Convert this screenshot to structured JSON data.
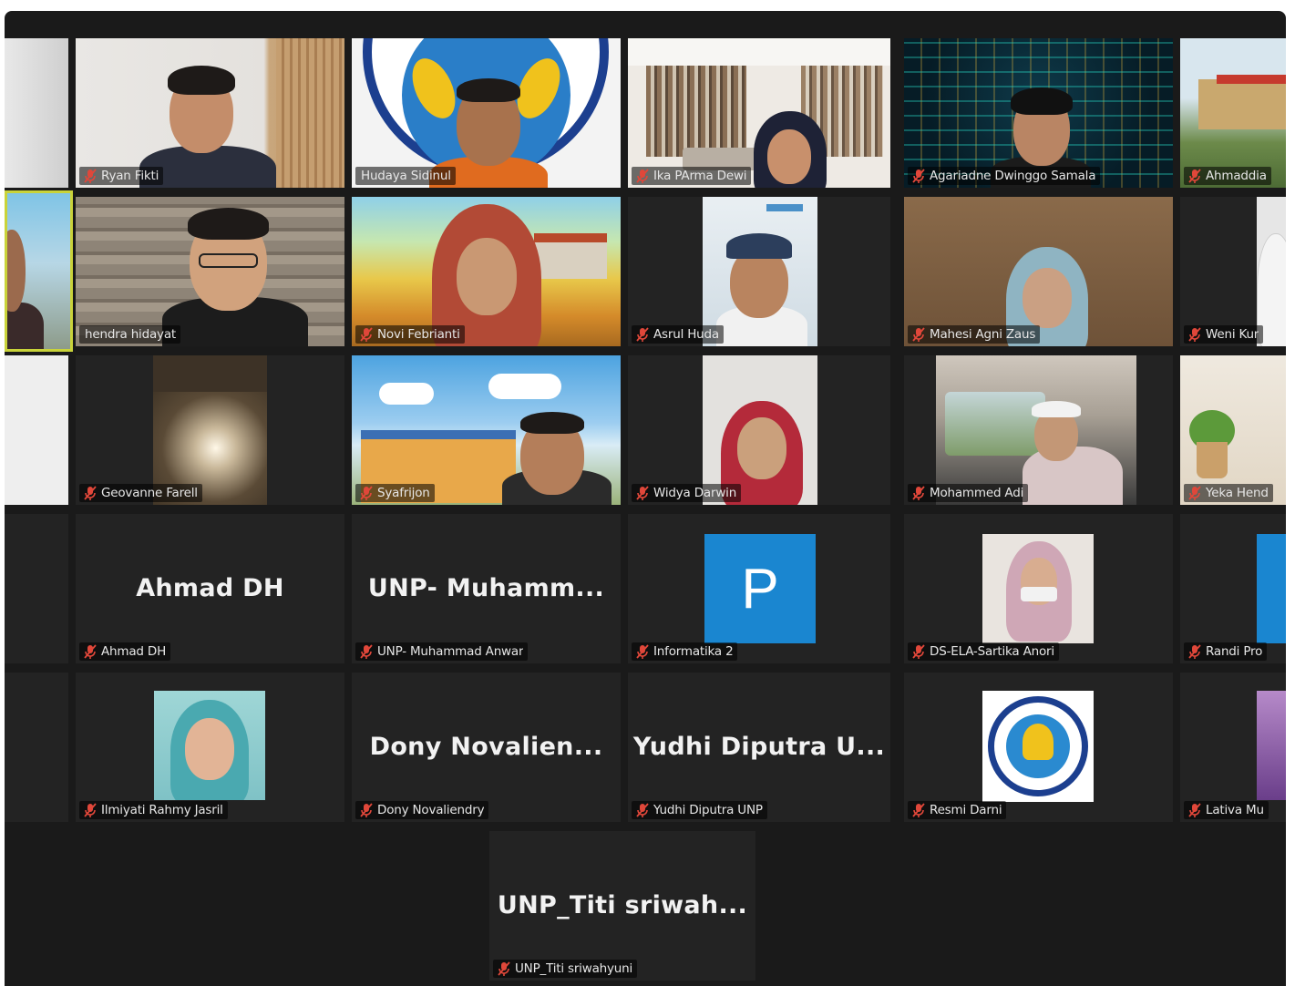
{
  "participants": [
    {
      "name": "Ryan Fikti"
    },
    {
      "name": "Hudaya Sidinul"
    },
    {
      "name": "Ika PArma Dewi"
    },
    {
      "name": "Agariadne Dwinggo Samala"
    },
    {
      "name": "Ahmaddia"
    },
    {
      "name": "hendra hidayat"
    },
    {
      "name": "Novi Febrianti"
    },
    {
      "name": "Asrul Huda"
    },
    {
      "name": "Mahesi Agni Zaus"
    },
    {
      "name": "Weni Kur"
    },
    {
      "name": "Geovanne Farell"
    },
    {
      "name": "Syafrijon"
    },
    {
      "name": "Widya Darwin"
    },
    {
      "name": "Mohammed Adi"
    },
    {
      "name": "Yeka Hend"
    },
    {
      "name": "Ahmad DH",
      "display": "Ahmad DH"
    },
    {
      "name": "UNP- Muhammad Anwar",
      "display": "UNP- Muhamm..."
    },
    {
      "name": "Informatika 2",
      "avatar_letter": "P"
    },
    {
      "name": "DS-ELA-Sartika Anori"
    },
    {
      "name": "Randi Pro"
    },
    {
      "name": "Ilmiyati Rahmy Jasril"
    },
    {
      "name": "Dony Novaliendry",
      "display": "Dony Novalien..."
    },
    {
      "name": "Yudhi Diputra UNP",
      "display": "Yudhi Diputra U..."
    },
    {
      "name": "Resmi Darni"
    },
    {
      "name": "Lativa Mu"
    },
    {
      "name": "UNP_Titi sriwahyuni",
      "display": "UNP_Titi sriwah..."
    }
  ],
  "colors": {
    "stage": "#1a1a1a",
    "tile": "#232323",
    "mic_muted": "#e0473a",
    "active_speaker_border": "#c9d33a",
    "avatar_blue": "#1a86d0"
  },
  "icons": {
    "mic": "microphone-muted-icon"
  }
}
